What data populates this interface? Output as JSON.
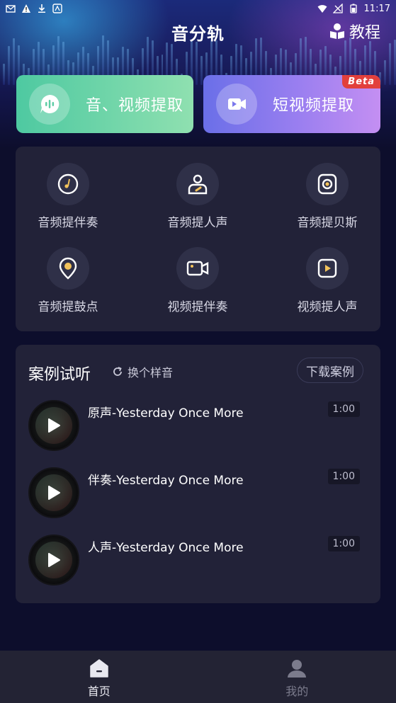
{
  "status_bar": {
    "time": "11:17"
  },
  "header": {
    "title": "音分轨",
    "tutorial_label": "教程"
  },
  "feature_cards": [
    {
      "label": "音、视频提取",
      "icon": "audio-bubble-icon"
    },
    {
      "label": "短视频提取",
      "icon": "video-camera-icon",
      "badge": "Beta"
    }
  ],
  "tools": [
    {
      "label": "音频提伴奏",
      "icon": "music-note-icon"
    },
    {
      "label": "音频提人声",
      "icon": "singer-icon"
    },
    {
      "label": "音频提贝斯",
      "icon": "speaker-icon"
    },
    {
      "label": "音频提鼓点",
      "icon": "drum-pin-icon"
    },
    {
      "label": "视频提伴奏",
      "icon": "video-camera-icon"
    },
    {
      "label": "视频提人声",
      "icon": "video-play-icon"
    }
  ],
  "cases": {
    "title": "案例试听",
    "refresh_label": "换个样音",
    "download_label": "下载案例",
    "tracks": [
      {
        "name": "原声-Yesterday Once More",
        "duration": "1:00"
      },
      {
        "name": "伴奏-Yesterday Once More",
        "duration": "1:00"
      },
      {
        "name": "人声-Yesterday Once More",
        "duration": "1:00"
      }
    ]
  },
  "bottom_nav": [
    {
      "label": "首页",
      "icon": "home-icon",
      "active": true
    },
    {
      "label": "我的",
      "icon": "profile-icon",
      "active": false
    }
  ],
  "colors": {
    "background": "#0d0e2c",
    "panel": "#222238",
    "audio_card_start": "#4ec9a1",
    "video_card_start": "#6a6fe8",
    "beta_badge": "#e2403c"
  }
}
